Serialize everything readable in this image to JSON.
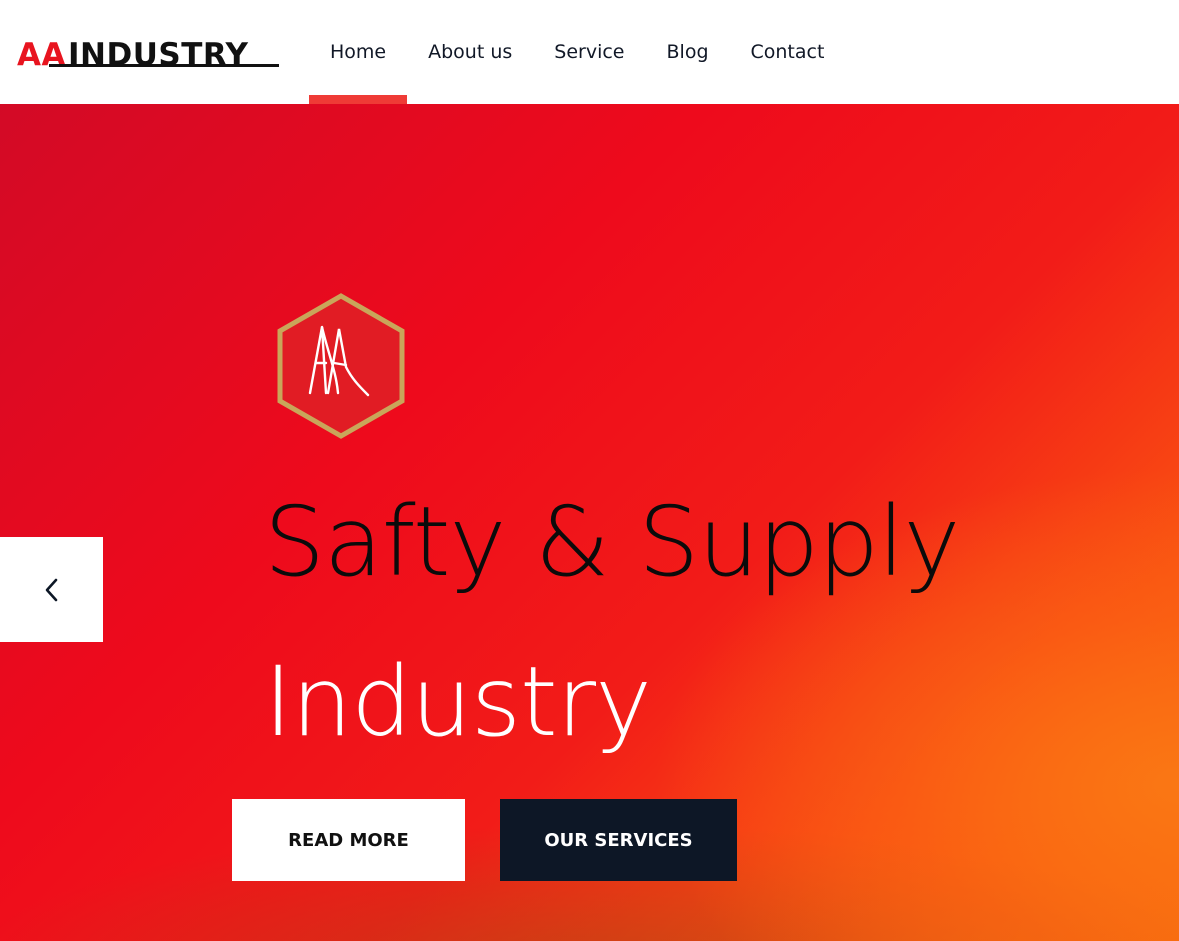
{
  "header": {
    "logo": {
      "part1": "AA",
      "part2": "INDUSTRY"
    },
    "nav": [
      {
        "label": "Home",
        "active": true
      },
      {
        "label": "About us",
        "active": false
      },
      {
        "label": "Service",
        "active": false
      },
      {
        "label": "Blog",
        "active": false
      },
      {
        "label": "Contact",
        "active": false
      }
    ]
  },
  "hero": {
    "emblem": {
      "letters": "AA",
      "icon": "hexagon-aa-logo-icon"
    },
    "title_line1": "Safty & Supply",
    "title_line2": "Industry",
    "buttons": {
      "read_more": "READ MORE",
      "our_services": "OUR SERVICES"
    },
    "prev_icon": "chevron-left-icon"
  },
  "colors": {
    "brand_red": "#e8141f",
    "nav_active": "#ef3b36",
    "dark_button": "#0d1726",
    "hero_start": "#d30a26",
    "hero_end": "#f77a0a",
    "emblem_border": "#c9a65a"
  }
}
